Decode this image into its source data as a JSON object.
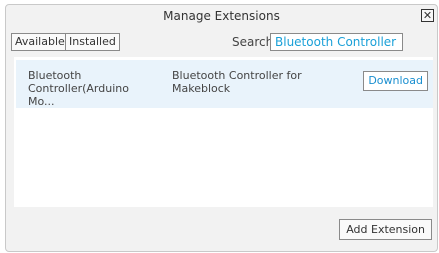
{
  "window": {
    "title": "Manage Extensions",
    "close_glyph": "✕"
  },
  "toolbar": {
    "tabs": [
      {
        "label": "Available"
      },
      {
        "label": "Installed"
      }
    ],
    "search_label": "Search",
    "search_value": "Bluetooth Controller"
  },
  "extensions": [
    {
      "name": "Bluetooth Controller(Arduino Mo...",
      "description": "Bluetooth Controller for Makeblock",
      "action_label": "Download"
    }
  ],
  "footer": {
    "add_label": "Add Extension"
  },
  "colors": {
    "accent": "#1a8fd0",
    "row_highlight": "#e9f3fb",
    "panel_bg": "#f2f2f2"
  }
}
